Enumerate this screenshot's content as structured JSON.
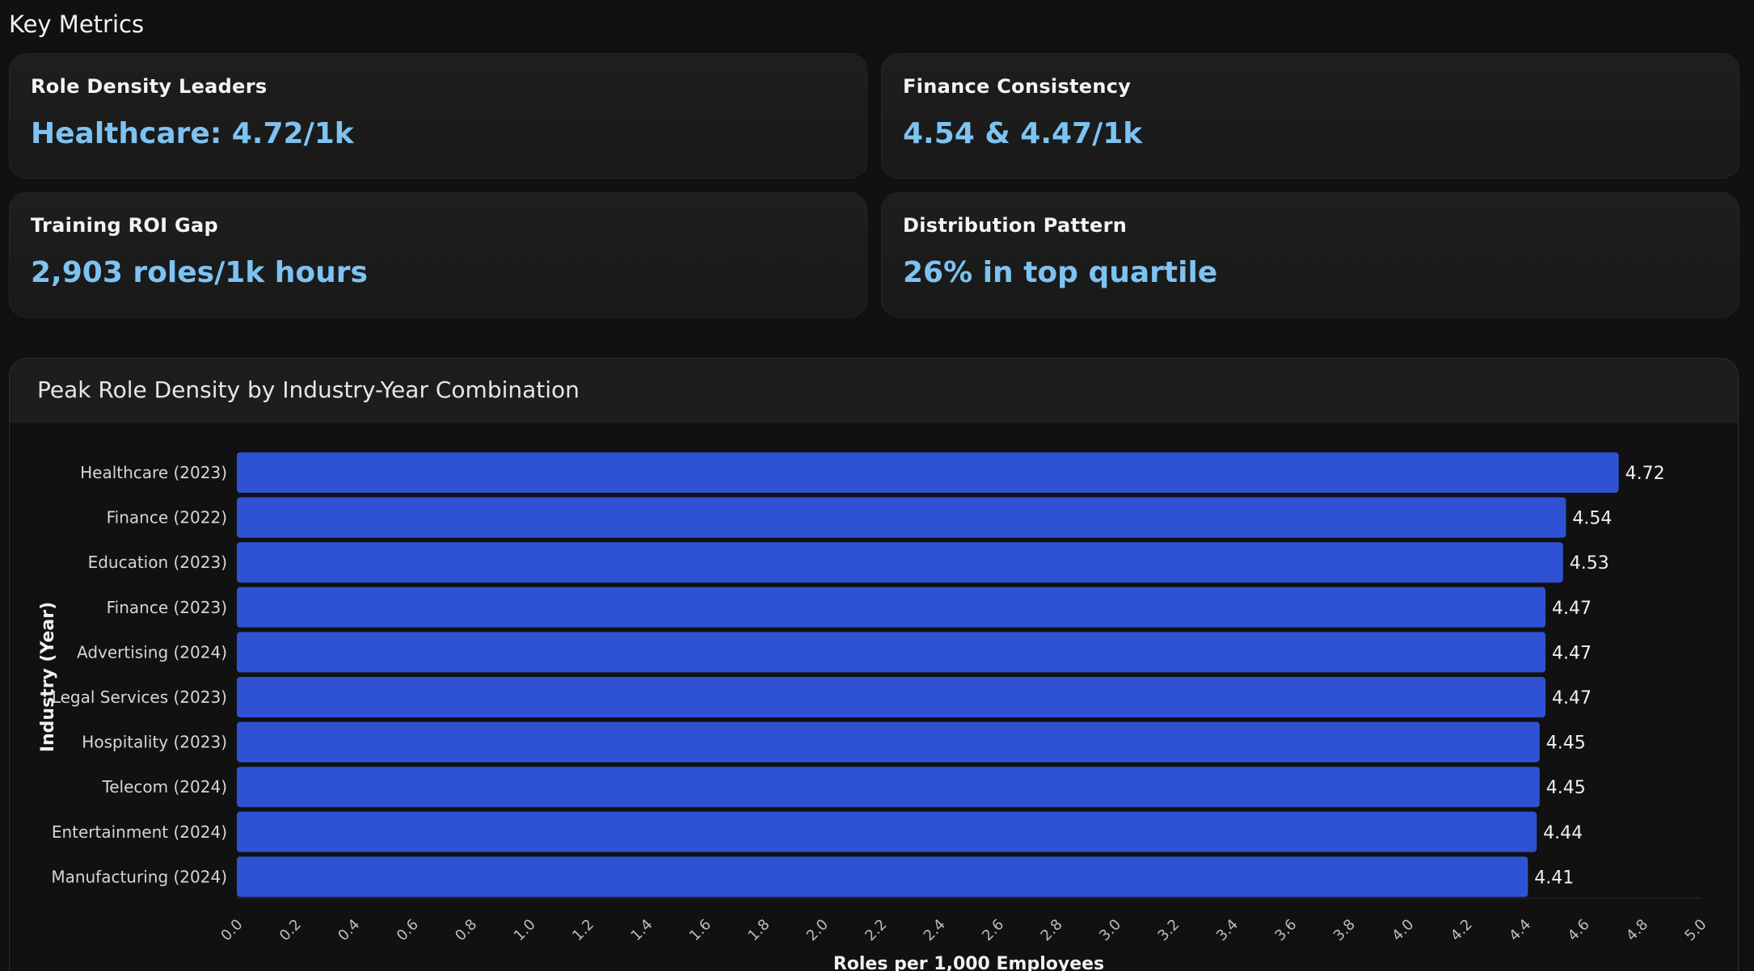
{
  "section_title": "Key Metrics",
  "cards": [
    {
      "label": "Role Density Leaders",
      "value": "Healthcare: 4.72/1k"
    },
    {
      "label": "Finance Consistency",
      "value": "4.54 & 4.47/1k"
    },
    {
      "label": "Training ROI Gap",
      "value": "2,903 roles/1k hours"
    },
    {
      "label": "Distribution Pattern",
      "value": "26% in top quartile"
    }
  ],
  "colors": {
    "bar": "#2f52d4",
    "value_accent": "#7dc3f2"
  },
  "chart_data": {
    "type": "bar",
    "orientation": "horizontal",
    "title": "Peak Role Density by Industry-Year Combination",
    "xlabel": "Roles per 1,000 Employees",
    "ylabel": "Industry (Year)",
    "xlim": [
      0,
      5.0
    ],
    "x_ticks": [
      "0.0",
      "0.2",
      "0.4",
      "0.6",
      "0.8",
      "1.0",
      "1.2",
      "1.4",
      "1.6",
      "1.8",
      "2.0",
      "2.2",
      "2.4",
      "2.6",
      "2.8",
      "3.0",
      "3.2",
      "3.4",
      "3.6",
      "3.8",
      "4.0",
      "4.2",
      "4.4",
      "4.6",
      "4.8",
      "5.0"
    ],
    "categories": [
      "Healthcare (2023)",
      "Finance (2022)",
      "Education (2023)",
      "Finance (2023)",
      "Advertising (2024)",
      "Legal Services (2023)",
      "Hospitality (2023)",
      "Telecom (2024)",
      "Entertainment (2024)",
      "Manufacturing (2024)"
    ],
    "values": [
      4.72,
      4.54,
      4.53,
      4.47,
      4.47,
      4.47,
      4.45,
      4.45,
      4.44,
      4.41
    ],
    "value_labels": [
      "4.72",
      "4.54",
      "4.53",
      "4.47",
      "4.47",
      "4.47",
      "4.45",
      "4.45",
      "4.44",
      "4.41"
    ],
    "grid": false,
    "legend": "none"
  }
}
